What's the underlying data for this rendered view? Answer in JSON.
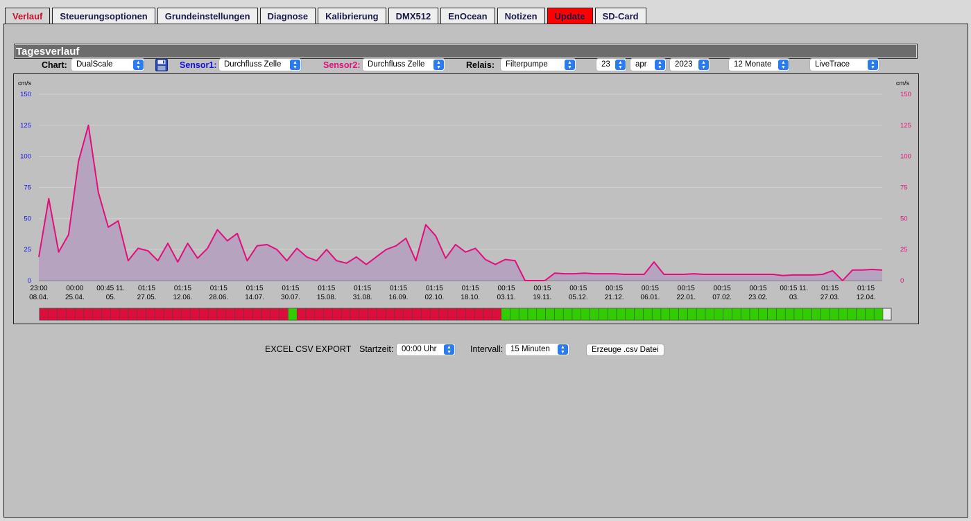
{
  "tabs": [
    {
      "label": "Verlauf",
      "state": "active"
    },
    {
      "label": "Steuerungsoptionen"
    },
    {
      "label": "Grundeinstellungen"
    },
    {
      "label": "Diagnose"
    },
    {
      "label": "Kalibrierung"
    },
    {
      "label": "DMX512"
    },
    {
      "label": "EnOcean"
    },
    {
      "label": "Notizen"
    },
    {
      "label": "Update",
      "state": "highlight"
    },
    {
      "label": "SD-Card"
    }
  ],
  "section_title": "Tagesverlauf",
  "controls": {
    "chart_label": "Chart:",
    "chart_value": "DualScale",
    "sensor1_label": "Sensor1:",
    "sensor1_value": "Durchfluss Zelle",
    "sensor2_label": "Sensor2:",
    "sensor2_value": "Durchfluss Zelle",
    "relais_label": "Relais:",
    "relais_value": "Filterpumpe",
    "day_value": "23",
    "month_value": "apr",
    "year_value": "2023",
    "range_value": "12 Monate",
    "mode_value": "LiveTrace"
  },
  "colors": {
    "sensor1": "#1010e0",
    "sensor2": "#e0107a",
    "area_fill": "#b49ec0",
    "relay_off": "#dc0e3c",
    "relay_on": "#33cc00",
    "update_tab": "#ff0000"
  },
  "chart_data": {
    "type": "area",
    "left_unit": "cm/s",
    "right_unit": "cm/s",
    "ylim": [
      0,
      150
    ],
    "y_ticks": [
      0,
      25,
      50,
      75,
      100,
      125,
      150
    ],
    "grid": true,
    "x_tick_labels": [
      {
        "time": "23:00",
        "date": "08.04."
      },
      {
        "time": "00:00",
        "date": "25.04."
      },
      {
        "time": "00:45 11.",
        "date": "05."
      },
      {
        "time": "01:15",
        "date": "27.05."
      },
      {
        "time": "01:15",
        "date": "12.06."
      },
      {
        "time": "01:15",
        "date": "28.06."
      },
      {
        "time": "01:15",
        "date": "14.07."
      },
      {
        "time": "01:15",
        "date": "30.07."
      },
      {
        "time": "01:15",
        "date": "15.08."
      },
      {
        "time": "01:15",
        "date": "31.08."
      },
      {
        "time": "01:15",
        "date": "16.09."
      },
      {
        "time": "01:15",
        "date": "02.10."
      },
      {
        "time": "01:15",
        "date": "18.10."
      },
      {
        "time": "00:15",
        "date": "03.11."
      },
      {
        "time": "00:15",
        "date": "19.11."
      },
      {
        "time": "00:15",
        "date": "05.12."
      },
      {
        "time": "00:15",
        "date": "21.12."
      },
      {
        "time": "00:15",
        "date": "06.01."
      },
      {
        "time": "00:15",
        "date": "22.01."
      },
      {
        "time": "00:15",
        "date": "07.02."
      },
      {
        "time": "00:15",
        "date": "23.02."
      },
      {
        "time": "00:15 11.",
        "date": "03."
      },
      {
        "time": "01:15",
        "date": "27.03."
      },
      {
        "time": "01:15",
        "date": "12.04."
      }
    ],
    "values": [
      19,
      66,
      23,
      37,
      96,
      125,
      71,
      43,
      48,
      16,
      26,
      24,
      16,
      30,
      15,
      30,
      18,
      26,
      41,
      32,
      38,
      16,
      28,
      29,
      25,
      16,
      26,
      19,
      16,
      25,
      16,
      14,
      19,
      13,
      19,
      25,
      28,
      34,
      16,
      45,
      36,
      18,
      29,
      23,
      26,
      17,
      13,
      17,
      16,
      0,
      0,
      0,
      6,
      5.5,
      5.5,
      6,
      5.5,
      5.5,
      5.5,
      5,
      5,
      5,
      15,
      5,
      5,
      5,
      5.5,
      5,
      5,
      5,
      5,
      5,
      5,
      5,
      5,
      4,
      4.5,
      4.5,
      4.5,
      5,
      8,
      0,
      8.5,
      8.5,
      9,
      8.5
    ],
    "relay_states": [
      0,
      0,
      0,
      0,
      0,
      0,
      0,
      0,
      0,
      0,
      0,
      0,
      0,
      0,
      0,
      0,
      0,
      0,
      0,
      0,
      0,
      0,
      0,
      0,
      0,
      0,
      0,
      0,
      1,
      0,
      0,
      0,
      0,
      0,
      0,
      0,
      0,
      0,
      0,
      0,
      0,
      0,
      0,
      0,
      0,
      0,
      0,
      0,
      0,
      0,
      0,
      0,
      1,
      1,
      1,
      1,
      1,
      1,
      1,
      1,
      1,
      1,
      1,
      1,
      1,
      1,
      1,
      1,
      1,
      1,
      1,
      1,
      1,
      1,
      1,
      1,
      1,
      1,
      1,
      1,
      1,
      1,
      1,
      1,
      1,
      1,
      1,
      1,
      1,
      1,
      1,
      1,
      1,
      1,
      1
    ]
  },
  "export": {
    "label": "EXCEL CSV EXPORT",
    "start_label": "Startzeit:",
    "start_value": "00:00 Uhr",
    "interval_label": "Intervall:",
    "interval_value": "15 Minuten",
    "button_label": "Erzeuge .csv Datei"
  }
}
